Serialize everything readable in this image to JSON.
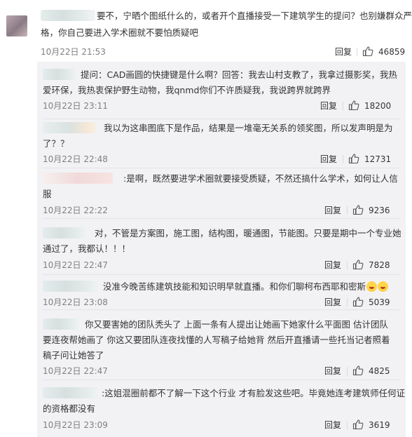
{
  "main_comment": {
    "text_line1": "要不，宁晒个图纸什么的，或者开个直播接受一下建筑学生的提问？也别嫌群众严",
    "text_line2": "格，你自己要进入学术圈就不要怕质疑吧",
    "time": "10月22日 21:53",
    "reply_label": "回复",
    "likes": "46859"
  },
  "replies": [
    {
      "line1": "提问：CAD画圆的快捷键是什么啊？回答：我去山村支教了，我拿过摄影奖，我热",
      "line2": "爱环保，我热衷保护野生动物，我qnmd你们不许质疑我，我说跨界就跨界",
      "time": "10月22日 23:11",
      "reply_label": "回复",
      "likes": "18200"
    },
    {
      "line1": "我以为这串图底下是作品，结果是一堆毫无关系的领奖图，所以发声明是为",
      "line2": "了？？",
      "time": "10月22日 22:48",
      "reply_label": "回复",
      "likes": "12731"
    },
    {
      "line1": ":是啊，既然要进学术圈就要接受质疑，不然还搞什么学术，如何让人信",
      "line2": "服",
      "time": "10月22日 22:22",
      "reply_label": "回复",
      "likes": "9236"
    },
    {
      "line1": "对，不管是方案图，施工图，结构图，暖通图，节能图。只要是期中一个专业她",
      "line2": "通过了，我都认！！！",
      "time": "10月22日 22:47",
      "reply_label": "回复",
      "likes": "7828"
    },
    {
      "line1": "没准今晚苦练建筑技能和知识明早就直播。和你们聊柯布西耶和密斯",
      "line2": "",
      "time": "10月22日 23:08",
      "reply_label": "回复",
      "likes": "5039"
    },
    {
      "line1": "你又要害她的团队秃头了  上面一条有人提出让她画下她家什么平面图  估计团队",
      "line2": "要连夜帮她画了  你这又要团队连夜找懂的人写稿子给她背  然后开直播请一些托当记者照着",
      "line3": "稿子问让她答了",
      "time": "10月22日 22:47",
      "reply_label": "回复",
      "likes": "4825"
    },
    {
      "line1": ":这姐混圈前都不了解一下这个行业 才有脸发这些吧。毕竟她连考建筑师任何证",
      "line2": "的资格都没有",
      "time": "10月22日 23:09",
      "reply_label": "回复",
      "likes": "3619"
    }
  ]
}
